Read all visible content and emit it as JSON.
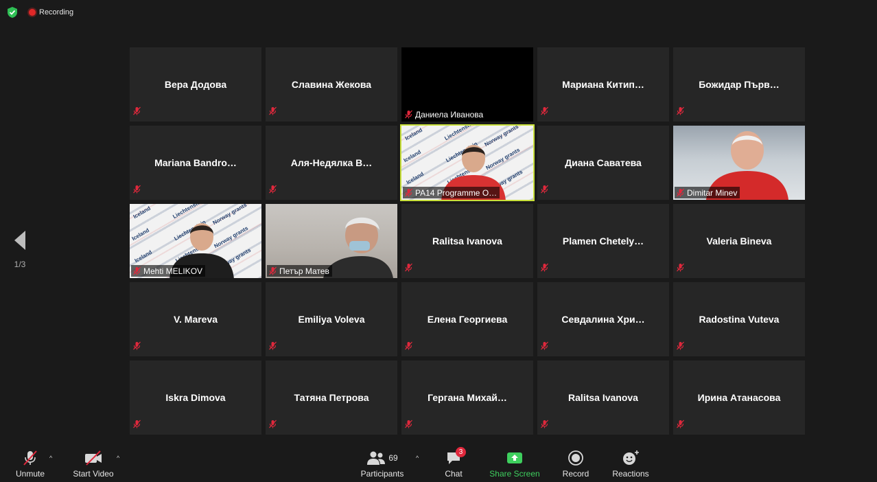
{
  "status": {
    "recording_label": "Recording"
  },
  "pager": {
    "page_indicator": "1/3"
  },
  "participants": [
    {
      "name": "Вера Додова",
      "video": false
    },
    {
      "name": "Славина Жекова",
      "video": false
    },
    {
      "name": "Даниела Иванова",
      "video": "black"
    },
    {
      "name": "Мариана  Китип…",
      "video": false
    },
    {
      "name": "Божидар  Първ…",
      "video": false
    },
    {
      "name": "Mariana  Bandro…",
      "video": false
    },
    {
      "name": "Аля-Недялка  В…",
      "video": false
    },
    {
      "name": "PA14 Programme O…",
      "video": "logo",
      "active": true
    },
    {
      "name": "Диана Саватева",
      "video": false
    },
    {
      "name": "Dimitar Minev",
      "video": "office"
    },
    {
      "name": "Mehti MELIKOV",
      "video": "logo"
    },
    {
      "name": "Петър Матев",
      "video": "grey"
    },
    {
      "name": "Ralitsa Ivanova",
      "video": false
    },
    {
      "name": "Plamen  Chetely…",
      "video": false
    },
    {
      "name": "Valeria Bineva",
      "video": false
    },
    {
      "name": "V. Mareva",
      "video": false
    },
    {
      "name": "Emiliya Voleva",
      "video": false
    },
    {
      "name": "Елена Георгиева",
      "video": false
    },
    {
      "name": "Севдалина  Хри…",
      "video": false
    },
    {
      "name": "Radostina Vuteva",
      "video": false
    },
    {
      "name": "Iskra Dimova",
      "video": false
    },
    {
      "name": "Татяна Петрова",
      "video": false
    },
    {
      "name": "Гергана  Михай…",
      "video": false
    },
    {
      "name": "Ralitsa Ivanova",
      "video": false
    },
    {
      "name": "Ирина Атанасова",
      "video": false
    }
  ],
  "logo_words": [
    "Iceland",
    "Liechtenstein",
    "Norway grants"
  ],
  "toolbar": {
    "unmute": "Unmute",
    "start_video": "Start Video",
    "participants": "Participants",
    "participants_count": "69",
    "chat": "Chat",
    "chat_badge": "3",
    "share_screen": "Share Screen",
    "record": "Record",
    "reactions": "Reactions"
  },
  "colors": {
    "background": "#1a1a1a",
    "tile": "#262626",
    "active_speaker": "#c8e03a",
    "share_green": "#3ecf5e",
    "mute_red": "#e0283c"
  }
}
